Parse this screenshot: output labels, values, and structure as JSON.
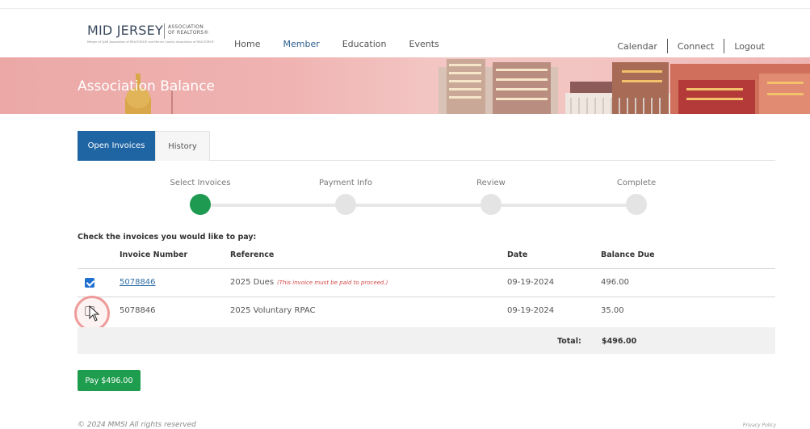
{
  "header": {
    "logo_main": "MID JERSEY",
    "logo_assoc_line1": "ASSOCIATION",
    "logo_assoc_line2": "OF REALTORS®",
    "logo_tagline": "Merger of CJAR Association of REALTORS® and Mercer County Association of REALTORS®",
    "nav_left": [
      "Home",
      "Member",
      "Education",
      "Events"
    ],
    "nav_active": "Member",
    "nav_right": [
      "Calendar",
      "Connect",
      "Logout"
    ]
  },
  "banner": {
    "title": "Association Balance"
  },
  "tabs": [
    {
      "label": "Open Invoices",
      "active": true
    },
    {
      "label": "History",
      "active": false
    }
  ],
  "stepper": [
    {
      "label": "Select Invoices",
      "complete": true
    },
    {
      "label": "Payment Info",
      "complete": false
    },
    {
      "label": "Review",
      "complete": false
    },
    {
      "label": "Complete",
      "complete": false
    }
  ],
  "instructions": "Check the invoices you would like to pay:",
  "table": {
    "headers": [
      "Invoice Number",
      "Reference",
      "Date",
      "Balance Due"
    ],
    "rows": [
      {
        "checked": true,
        "invoice": "5078846",
        "reference": "2025 Dues",
        "note": "(This invoice must be paid to proceed.)",
        "date": "09-19-2024",
        "balance": "496.00"
      },
      {
        "checked": false,
        "invoice": "5078846",
        "reference": "2025 Voluntary RPAC",
        "note": "",
        "date": "09-19-2024",
        "balance": "35.00"
      }
    ],
    "total_label": "Total:",
    "total_value": "$496.00"
  },
  "pay_button": "Pay $496.00",
  "footer": {
    "copyright": "© 2024 MMSI All rights reserved",
    "privacy": "Privacy Policy"
  },
  "colors": {
    "primary_blue": "#1f65a4",
    "success_green": "#1e9a51",
    "link_blue": "#2f6fa7",
    "warning_red": "#d44a4a",
    "banner_pink": "#efb3b1"
  }
}
